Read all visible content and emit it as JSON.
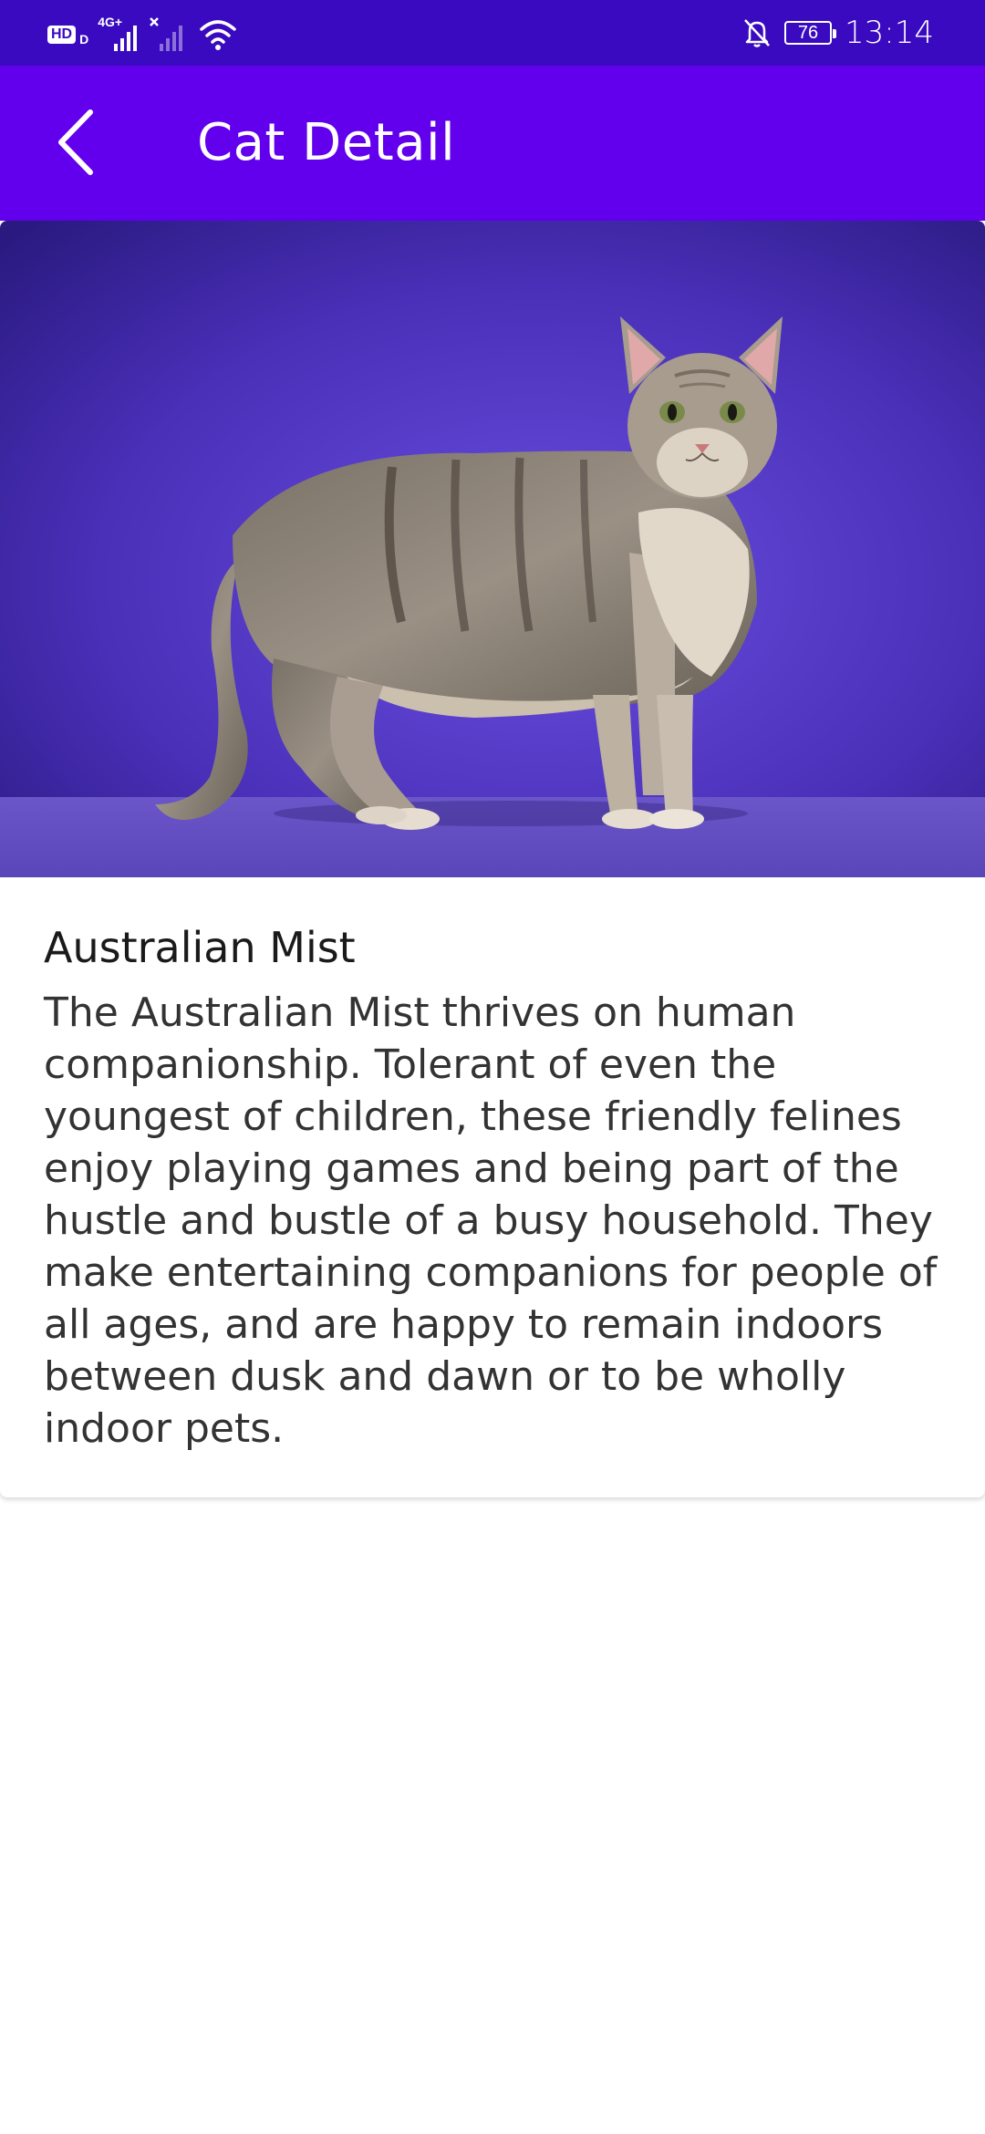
{
  "status_bar": {
    "hd_label": "HD",
    "hd_sub": "D",
    "network_label": "4G+",
    "battery_level": "76",
    "time": "13:14"
  },
  "app_bar": {
    "title": "Cat Detail"
  },
  "cat": {
    "name": "Australian Mist",
    "description": "The Australian Mist thrives on human companionship. Tolerant of even the youngest of children, these friendly felines enjoy playing games and being part of the hustle and bustle of a busy household. They make entertaining companions for people of all ages, and are happy to remain indoors between dusk and dawn or to be wholly indoor pets."
  },
  "colors": {
    "status_bar": "#3a0ac0",
    "app_bar": "#6200ee",
    "background": "#ffffff"
  },
  "icons": {
    "back": "chevron-left-icon",
    "signal": "signal-bars-icon",
    "wifi": "wifi-icon",
    "notifications_off": "bell-off-icon",
    "battery": "battery-icon"
  }
}
